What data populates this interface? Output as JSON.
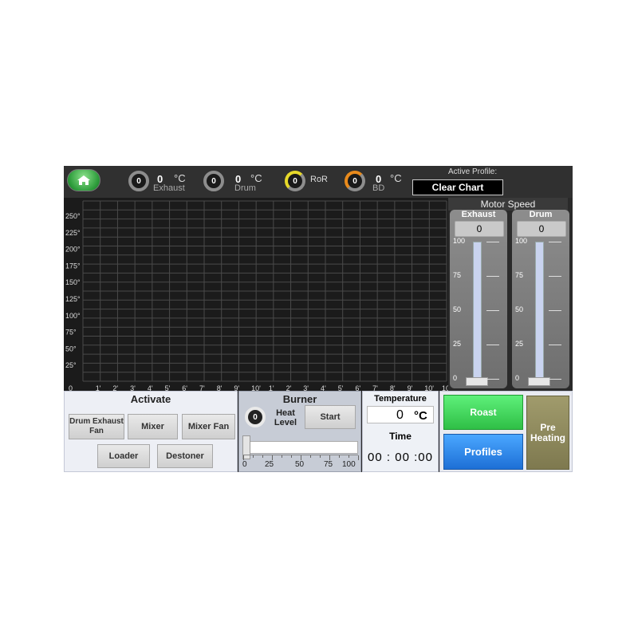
{
  "topbar": {
    "exhaust": {
      "gauge": "0",
      "value": "0",
      "unit": "°C",
      "label": "Exhaust"
    },
    "drum": {
      "gauge": "0",
      "value": "0",
      "unit": "°C",
      "label": "Drum"
    },
    "ror": {
      "gauge": "0",
      "label": "RoR"
    },
    "bd": {
      "gauge": "0",
      "value": "0",
      "unit": "°C",
      "label": "BD"
    },
    "active_profile_label": "Active Profile:",
    "clear_chart_label": "Clear Chart",
    "colors": {
      "home": "#2c9b3a",
      "ror_ring": "#e6d82a",
      "bd_ring": "#e88a1c"
    }
  },
  "chart_data": {
    "type": "line",
    "title": "",
    "xlabel": "",
    "ylabel": "",
    "y_ticks": [
      "250°",
      "225°",
      "200°",
      "175°",
      "150°",
      "125°",
      "100°",
      "75°",
      "50°",
      "25°"
    ],
    "x_ticks": [
      "0",
      "1'",
      "2'",
      "3'",
      "4'",
      "5'",
      "6'",
      "7'",
      "8'",
      "9'",
      "10'",
      "1'",
      "2'",
      "3'",
      "4'",
      "5'",
      "6'",
      "7'",
      "8'",
      "9'",
      "10'",
      "10'"
    ],
    "ylim": [
      0,
      250
    ],
    "grid": true,
    "series": []
  },
  "motor": {
    "title": "Motor Speed",
    "scale": [
      "100",
      "75",
      "50",
      "25",
      "0"
    ],
    "exhaust": {
      "label": "Exhaust",
      "value": "0"
    },
    "drum": {
      "label": "Drum",
      "value": "0"
    }
  },
  "activate": {
    "title": "Activate",
    "drum_exhaust_fan": "Drum Exhaust Fan",
    "mixer": "Mixer",
    "mixer_fan": "Mixer Fan",
    "loader": "Loader",
    "destoner": "Destoner"
  },
  "burner": {
    "title": "Burner",
    "level": "0",
    "heat_level_label": "Heat Level",
    "start_label": "Start",
    "scale": [
      "0",
      "25",
      "50",
      "75",
      "100"
    ],
    "slider_value": 0
  },
  "temperature": {
    "label": "Temperature",
    "value": "0",
    "unit": "°C",
    "time_label": "Time",
    "time_value": "00 : 00 :00"
  },
  "actions": {
    "roast": "Roast",
    "profiles": "Profiles",
    "pre_heating": "Pre Heating",
    "colors": {
      "roast": "#3fe05a",
      "profiles": "#2f8ff0",
      "pre_heating": "#8f8a5e"
    }
  }
}
